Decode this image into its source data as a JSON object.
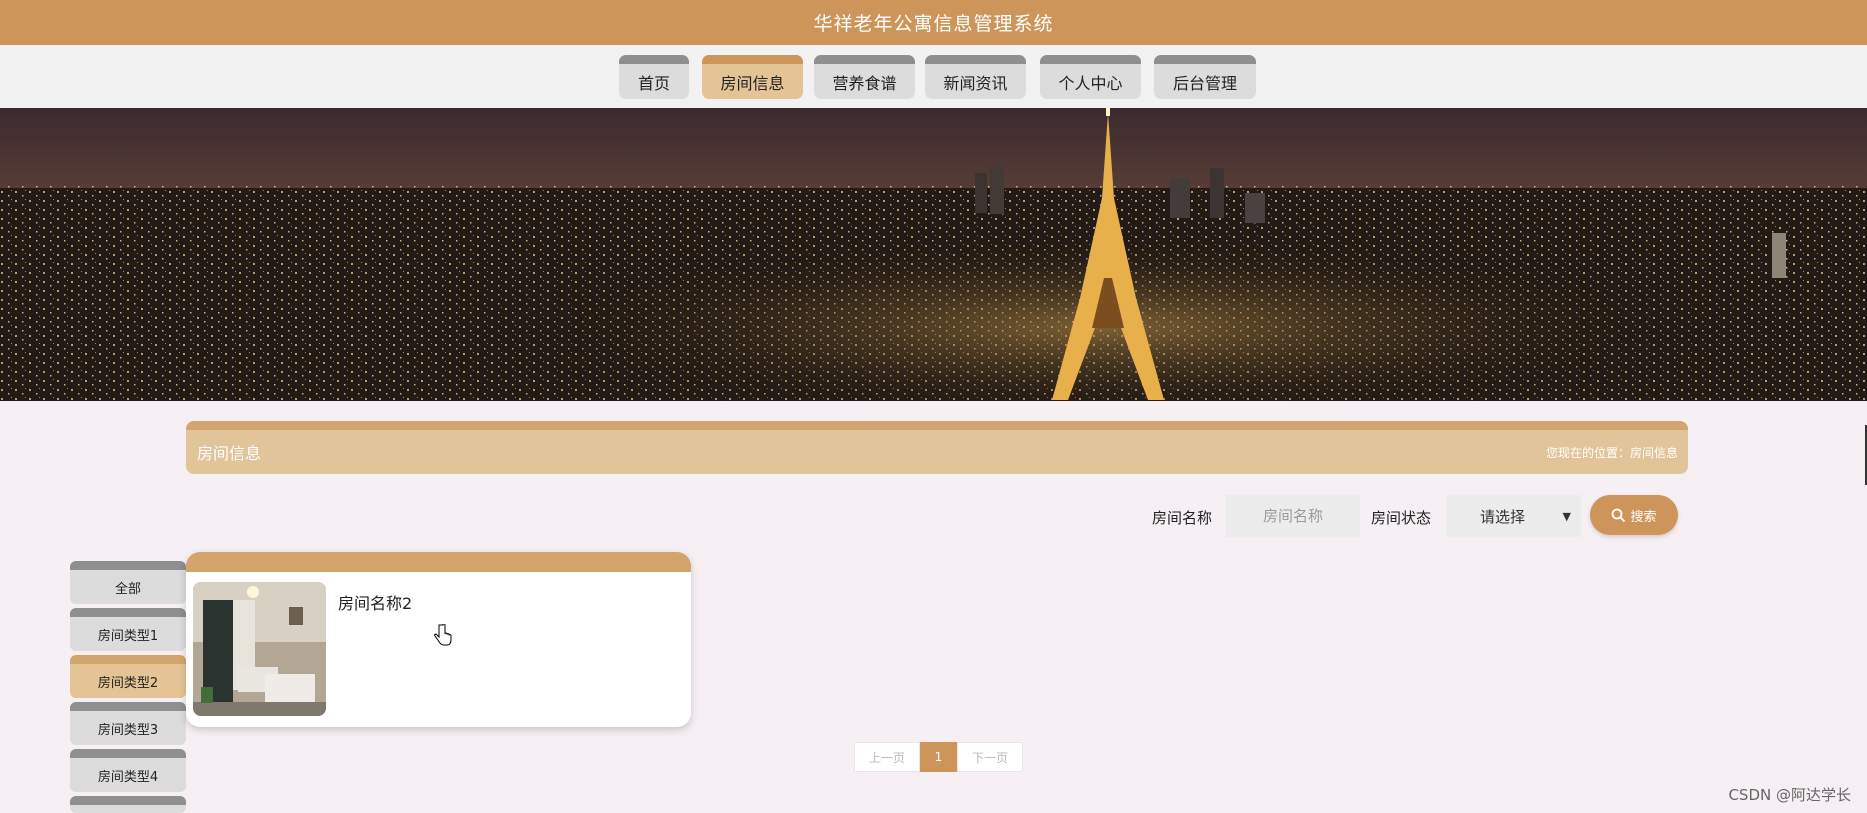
{
  "header": {
    "title": "华祥老年公寓信息管理系统"
  },
  "nav": {
    "items": [
      {
        "label": "首页"
      },
      {
        "label": "房间信息"
      },
      {
        "label": "营养食谱"
      },
      {
        "label": "新闻资讯"
      },
      {
        "label": "个人中心"
      },
      {
        "label": "后台管理"
      }
    ],
    "active_index": 1
  },
  "breadcrumb": {
    "title": "房间信息",
    "path": "您现在的位置：房间信息"
  },
  "search": {
    "name_label": "房间名称",
    "name_placeholder": "房间名称",
    "status_label": "房间状态",
    "status_value": "请选择",
    "button_label": "搜索"
  },
  "categories": {
    "items": [
      {
        "label": "全部"
      },
      {
        "label": "房间类型1"
      },
      {
        "label": "房间类型2"
      },
      {
        "label": "房间类型3"
      },
      {
        "label": "房间类型4"
      },
      {
        "label": ""
      }
    ],
    "active_index": 2
  },
  "rooms": [
    {
      "name": "房间名称2"
    }
  ],
  "pagination": {
    "prev": "上一页",
    "current": "1",
    "next": "下一页"
  },
  "watermark": "CSDN @阿达学长",
  "colors": {
    "primary": "#cd955a",
    "light_accent": "#e4c394",
    "tab_gray": "#dcdcdc"
  }
}
